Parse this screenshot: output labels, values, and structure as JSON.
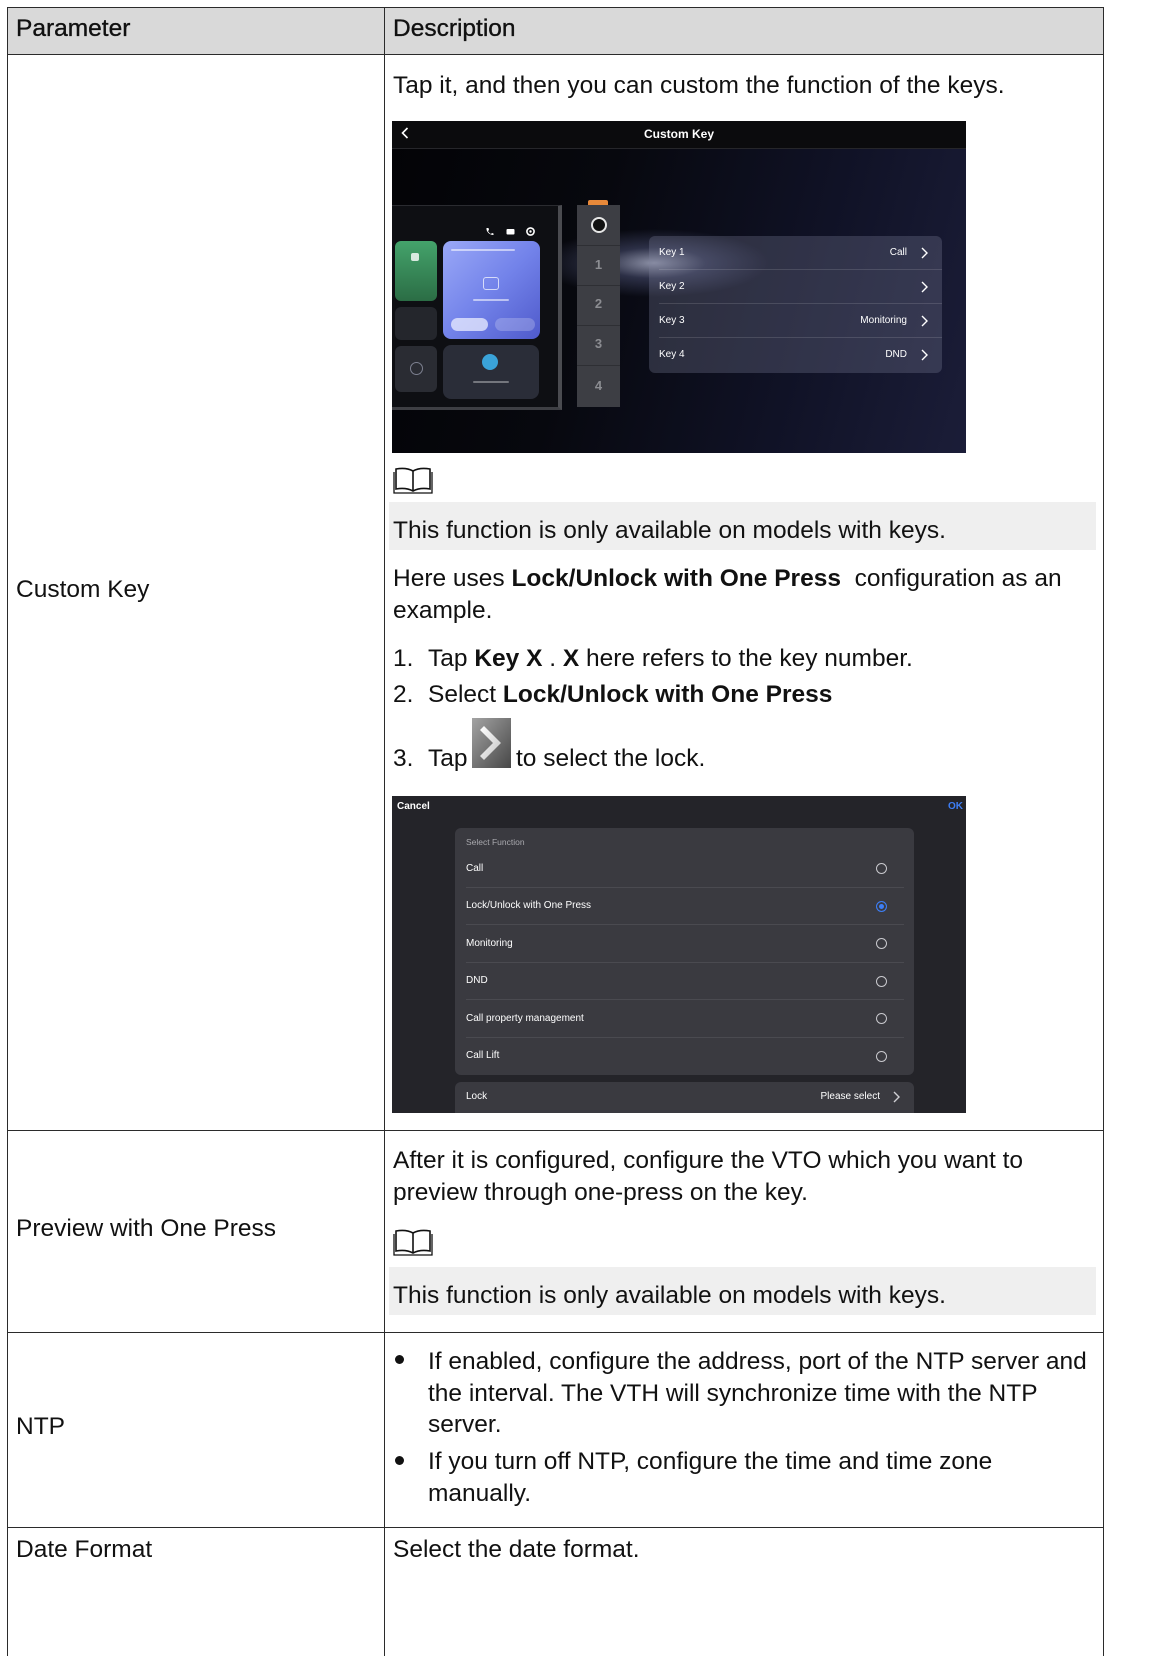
{
  "table": {
    "header": {
      "parameter": "Parameter",
      "description": "Description"
    },
    "custom_key": {
      "parameter": "Custom Key",
      "intro": "Tap it, and then you can custom the function of the keys.",
      "screen": {
        "title": "Custom Key",
        "device_key_numbers": [
          "1",
          "2",
          "3",
          "4"
        ],
        "keys": [
          {
            "label": "Key 1",
            "value": "Call"
          },
          {
            "label": "Key 2"
          },
          {
            "label": "Key 3",
            "value": "Monitoring"
          },
          {
            "label": "Key 4",
            "value": "DND"
          }
        ]
      },
      "note_icon": "book-icon",
      "note": "This function is only available on models with keys.",
      "example": {
        "before": "Here uses ",
        "bold": "Lock/Unlock with One Press",
        "after": "  configuration as an example."
      },
      "steps": [
        {
          "num": "1.",
          "text_1": "Tap ",
          "bold_1": "Key X",
          "text_2": " . ",
          "bold_2": "X",
          "text_3": " here refers to the key number."
        },
        {
          "num": "2.",
          "text_1": "Select ",
          "bold_1": "Lock/Unlock with One Press"
        },
        {
          "num": "3.",
          "text_1": "Tap",
          "icon": "chevron-right-button-icon",
          "text_2": "to select the lock."
        }
      ],
      "select_screen": {
        "cancel": "Cancel",
        "ok": "OK",
        "section_label": "Select Function",
        "options": [
          "Call",
          "Lock/Unlock with One Press",
          "Monitoring",
          "DND",
          "Call property management",
          "Call Lift"
        ],
        "selected_index": 1,
        "lock_label": "Lock",
        "lock_value": "Please select"
      }
    },
    "preview": {
      "parameter": "Preview with One Press",
      "description": "After it is configured, configure the VTO which you want to preview through one-press on the key.",
      "note_icon": "book-icon",
      "note": "This function is only available on models with keys."
    },
    "ntp": {
      "parameter": "NTP",
      "bullets": [
        "If enabled, configure the address, port of the NTP server and the interval. The VTH will synchronize time with the NTP server.",
        "If you turn off NTP, configure the time and time zone manually."
      ]
    },
    "date_format": {
      "parameter": "Date Format",
      "description": "Select the date format."
    }
  },
  "colors": {
    "header_bg": "#d9d9d9",
    "note_bg": "#efefef",
    "accent_blue": "#3d7ef5",
    "rule": "#2b2b2b"
  }
}
